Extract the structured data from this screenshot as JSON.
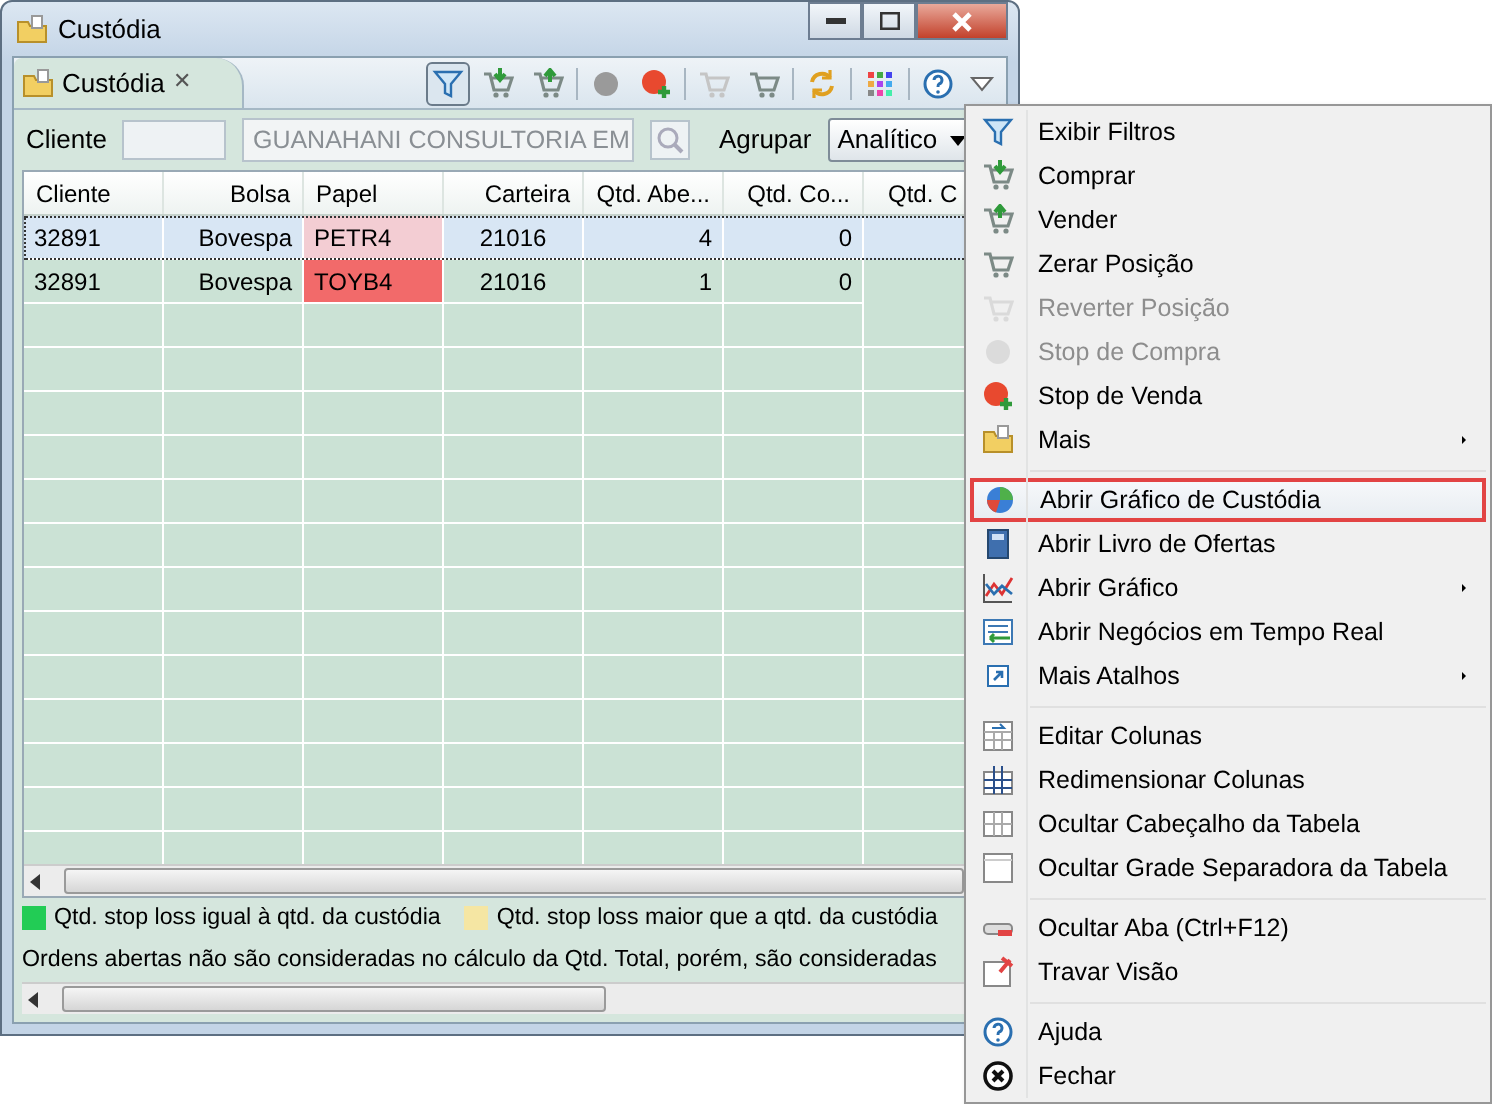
{
  "window": {
    "title": "Custódia"
  },
  "tab": {
    "label": "Custódia",
    "close": "✕"
  },
  "toolbar_buttons": [
    {
      "pressed": true
    },
    {
      "pressed": false
    },
    {
      "pressed": false
    },
    {
      "pressed": false
    },
    {
      "pressed": false
    },
    {
      "pressed": false
    },
    {
      "pressed": false
    },
    {
      "pressed": false
    },
    {
      "pressed": false
    },
    {
      "pressed": false
    }
  ],
  "filters": {
    "client_label": "Cliente",
    "client_value": "GUANAHANI CONSULTORIA EM",
    "group_label": "Agrupar",
    "group_value": "Analítico"
  },
  "table": {
    "columns": [
      "Cliente",
      "Bolsa",
      "Papel",
      "Carteira",
      "Qtd. Abe...",
      "Qtd. Co...",
      "Qtd. C"
    ],
    "rows": [
      {
        "cells": [
          "32891",
          "Bovespa",
          "PETR4",
          "21016",
          "4",
          "0"
        ],
        "selected": true,
        "color": "#f3cdd3"
      },
      {
        "cells": [
          "32891",
          "Bovespa",
          "TOYB4",
          "21016",
          "1",
          "0"
        ],
        "selected": false,
        "color": "#f26a6a"
      }
    ]
  },
  "legend": [
    {
      "color": "#22cc55",
      "label": "Qtd. stop loss igual à qtd. da custódia"
    },
    {
      "color": "#f5e6a3",
      "label": "Qtd. stop loss maior que a qtd. da custódia"
    }
  ],
  "footer_note": "Ordens abertas não são consideradas no cálculo da Qtd. Total, porém, são consideradas",
  "menu": [
    {
      "kind": "item",
      "label": "Exibir Filtros",
      "disabled": false,
      "submenu": false,
      "selected": false
    },
    {
      "kind": "item",
      "label": "Comprar",
      "disabled": false,
      "submenu": false,
      "selected": false
    },
    {
      "kind": "item",
      "label": "Vender",
      "disabled": false,
      "submenu": false,
      "selected": false
    },
    {
      "kind": "item",
      "label": "Zerar Posição",
      "disabled": false,
      "submenu": false,
      "selected": false
    },
    {
      "kind": "item",
      "label": "Reverter Posição",
      "disabled": true,
      "submenu": false,
      "selected": false
    },
    {
      "kind": "item",
      "label": "Stop de Compra",
      "disabled": true,
      "submenu": false,
      "selected": false
    },
    {
      "kind": "item",
      "label": "Stop de Venda",
      "disabled": false,
      "submenu": false,
      "selected": false
    },
    {
      "kind": "item",
      "label": "Mais",
      "disabled": false,
      "submenu": true,
      "selected": false
    },
    {
      "kind": "separator"
    },
    {
      "kind": "item",
      "label": "Abrir Gráfico de Custódia",
      "disabled": false,
      "submenu": false,
      "selected": true
    },
    {
      "kind": "item",
      "label": "Abrir Livro de Ofertas",
      "disabled": false,
      "submenu": false,
      "selected": false
    },
    {
      "kind": "item",
      "label": "Abrir Gráfico",
      "disabled": false,
      "submenu": true,
      "selected": false
    },
    {
      "kind": "item",
      "label": "Abrir Negócios em Tempo Real",
      "disabled": false,
      "submenu": false,
      "selected": false
    },
    {
      "kind": "item",
      "label": "Mais Atalhos",
      "disabled": false,
      "submenu": true,
      "selected": false
    },
    {
      "kind": "separator"
    },
    {
      "kind": "item",
      "label": "Editar Colunas",
      "disabled": false,
      "submenu": false,
      "selected": false
    },
    {
      "kind": "item",
      "label": "Redimensionar Colunas",
      "disabled": false,
      "submenu": false,
      "selected": false
    },
    {
      "kind": "item",
      "label": "Ocultar Cabeçalho da Tabela",
      "disabled": false,
      "submenu": false,
      "selected": false
    },
    {
      "kind": "item",
      "label": "Ocultar Grade Separadora da Tabela",
      "disabled": false,
      "submenu": false,
      "selected": false
    },
    {
      "kind": "separator"
    },
    {
      "kind": "item",
      "label": "Ocultar Aba (Ctrl+F12)",
      "disabled": false,
      "submenu": false,
      "selected": false
    },
    {
      "kind": "item",
      "label": "Travar Visão",
      "disabled": false,
      "submenu": false,
      "selected": false
    },
    {
      "kind": "separator"
    },
    {
      "kind": "item",
      "label": "Ajuda",
      "disabled": false,
      "submenu": false,
      "selected": false
    },
    {
      "kind": "item",
      "label": "Fechar",
      "disabled": false,
      "submenu": false,
      "selected": false
    }
  ]
}
